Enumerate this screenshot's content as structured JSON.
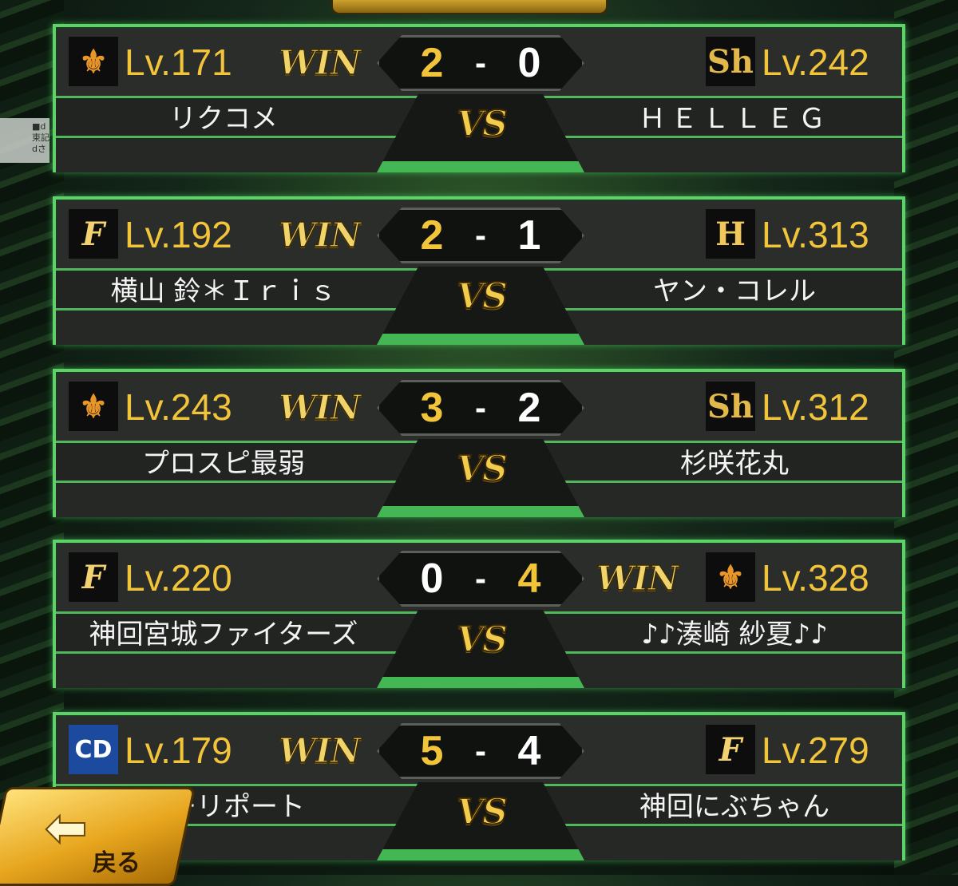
{
  "side_label": "■d\n東記\ndさ",
  "back_button": {
    "label": "戻る",
    "icon": "back-arrow-icon"
  },
  "matches": [
    {
      "left": {
        "team_icon": "giants-logo-icon",
        "level": "Lv.171",
        "name": "リクコメ",
        "win": "WIN"
      },
      "right": {
        "team_icon": "hawks-logo-icon",
        "level": "Lv.242",
        "name": "ＨＥＬＬＥＧ",
        "win": ""
      },
      "score_left": "2",
      "score_right": "0",
      "dash": "-",
      "vs": "VS"
    },
    {
      "left": {
        "team_icon": "fighters-logo-icon",
        "level": "Lv.192",
        "name": "横山 鈴＊Ｉｒｉｓ",
        "win": "WIN"
      },
      "right": {
        "team_icon": "tigers-logo-icon",
        "level": "Lv.313",
        "name": "ヤン・コレル",
        "win": ""
      },
      "score_left": "2",
      "score_right": "1",
      "dash": "-",
      "vs": "VS"
    },
    {
      "left": {
        "team_icon": "giants-logo-icon",
        "level": "Lv.243",
        "name": "プロスピ最弱",
        "win": "WIN"
      },
      "right": {
        "team_icon": "hawks-logo-icon",
        "level": "Lv.312",
        "name": "杉咲花丸",
        "win": ""
      },
      "score_left": "3",
      "score_right": "2",
      "dash": "-",
      "vs": "VS"
    },
    {
      "left": {
        "team_icon": "fighters-logo-icon",
        "level": "Lv.220",
        "name": "神回宮城ファイターズ",
        "win": ""
      },
      "right": {
        "team_icon": "giants-logo-icon",
        "level": "Lv.328",
        "name": "♪♪湊崎 紗夏♪♪",
        "win": "WIN"
      },
      "score_left": "0",
      "score_right": "4",
      "dash": "-",
      "vs": "VS"
    },
    {
      "left": {
        "team_icon": "dragons-logo-icon",
        "level": "Lv.179",
        "name": "ゲーリポート",
        "win": "WIN"
      },
      "right": {
        "team_icon": "fighters-logo-icon",
        "level": "Lv.279",
        "name": "神回にぶちゃん",
        "win": ""
      },
      "score_left": "5",
      "score_right": "4",
      "dash": "-",
      "vs": "VS"
    }
  ],
  "colors": {
    "frame_green": "#5fd06a",
    "gold": "#f2c43a",
    "panel": "#2b2d2b"
  },
  "logo_glyphs": {
    "giants": "⚜",
    "hawks": "Sh",
    "fighters": "F",
    "tigers": "H",
    "dragons": "CD"
  }
}
